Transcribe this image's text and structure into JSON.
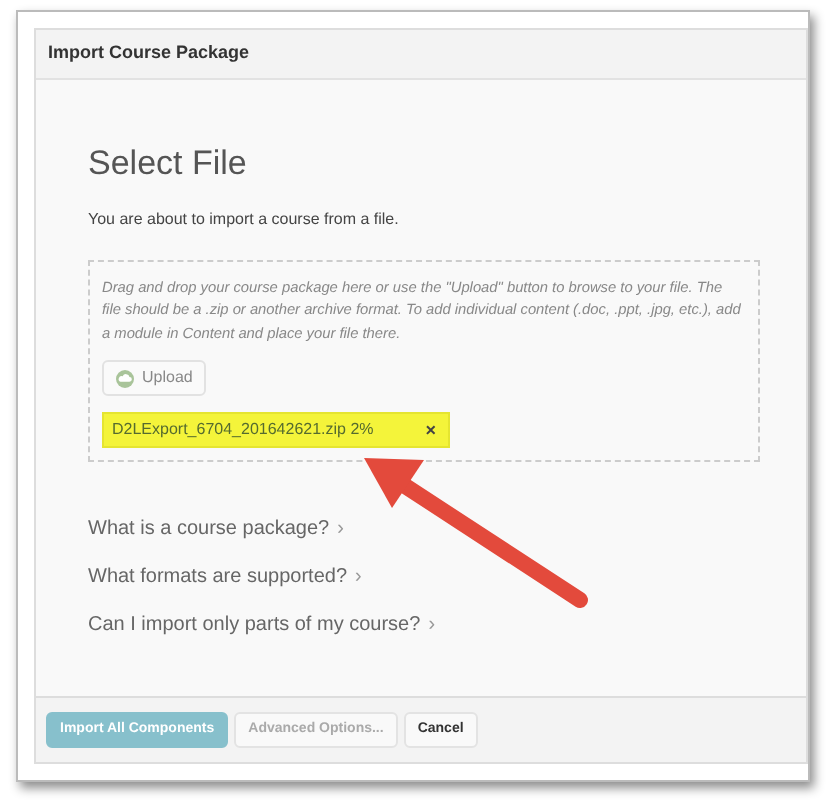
{
  "dialog": {
    "title": "Import Course Package"
  },
  "heading": "Select File",
  "intro": "You are about to import a course from a file.",
  "dropzone": {
    "instructions": "Drag and drop your course package here or use the \"Upload\" button to browse to your file. The file should be a .zip or another archive format. To add individual content (.doc, .ppt, .jpg, etc.), add a module in Content and place your file there.",
    "upload_button": "Upload",
    "file": {
      "name": "D2LExport_6704_201642621.zip 2%",
      "highlighted": true,
      "remove": "×"
    }
  },
  "help_links": [
    {
      "label": "What is a course package?",
      "chevron": "›"
    },
    {
      "label": "What formats are supported?",
      "chevron": "›"
    },
    {
      "label": "Can I import only parts of my course?",
      "chevron": "›"
    }
  ],
  "buttons": [
    {
      "label": "Import All Components",
      "kind": "primary",
      "disabled": true
    },
    {
      "label": "Advanced Options...",
      "kind": "secondary",
      "disabled": true
    },
    {
      "label": "Cancel",
      "kind": "secondary",
      "disabled": false
    }
  ]
}
